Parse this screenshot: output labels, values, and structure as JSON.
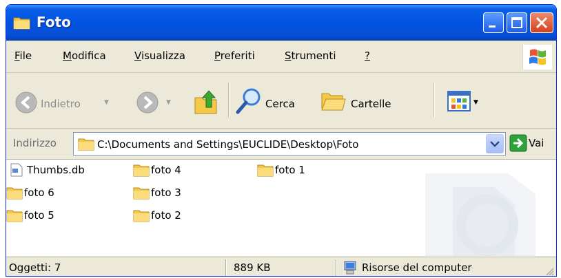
{
  "window": {
    "title": "Foto"
  },
  "menu": {
    "items": [
      {
        "pre": "",
        "key": "F",
        "post": "ile"
      },
      {
        "pre": "",
        "key": "M",
        "post": "odifica"
      },
      {
        "pre": "",
        "key": "V",
        "post": "isualizza"
      },
      {
        "pre": "",
        "key": "P",
        "post": "referiti"
      },
      {
        "pre": "",
        "key": "S",
        "post": "trumenti"
      },
      {
        "pre": "",
        "key": "?",
        "post": ""
      }
    ]
  },
  "toolbar": {
    "back_label": "Indietro",
    "search_label": "Cerca",
    "folders_label": "Cartelle"
  },
  "address": {
    "label": "Indirizzo",
    "path": "C:\\Documents and Settings\\EUCLIDE\\Desktop\\Foto",
    "go_label": "Vai"
  },
  "files": [
    {
      "name": "Thumbs.db",
      "type": "file"
    },
    {
      "name": "foto 6",
      "type": "folder"
    },
    {
      "name": "foto 5",
      "type": "folder"
    },
    {
      "name": "foto 4",
      "type": "folder"
    },
    {
      "name": "foto 3",
      "type": "folder"
    },
    {
      "name": "foto 2",
      "type": "folder"
    },
    {
      "name": "foto 1",
      "type": "folder"
    }
  ],
  "status": {
    "objects": "Oggetti: 7",
    "size": "889 KB",
    "location": "Risorse del computer"
  },
  "colors": {
    "titlebar": "#0053e1",
    "chrome": "#ece9d8",
    "folder": "#f4c84a",
    "go_arrow": "#2ea33b",
    "close_button": "#d3411b"
  },
  "icons": {
    "title": "folder-icon",
    "back": "back-arrow-icon",
    "forward": "forward-arrow-icon",
    "up": "folder-up-icon",
    "search": "search-icon",
    "folders": "folders-icon",
    "views": "views-icon",
    "go": "go-arrow-icon",
    "computer": "computer-icon"
  }
}
